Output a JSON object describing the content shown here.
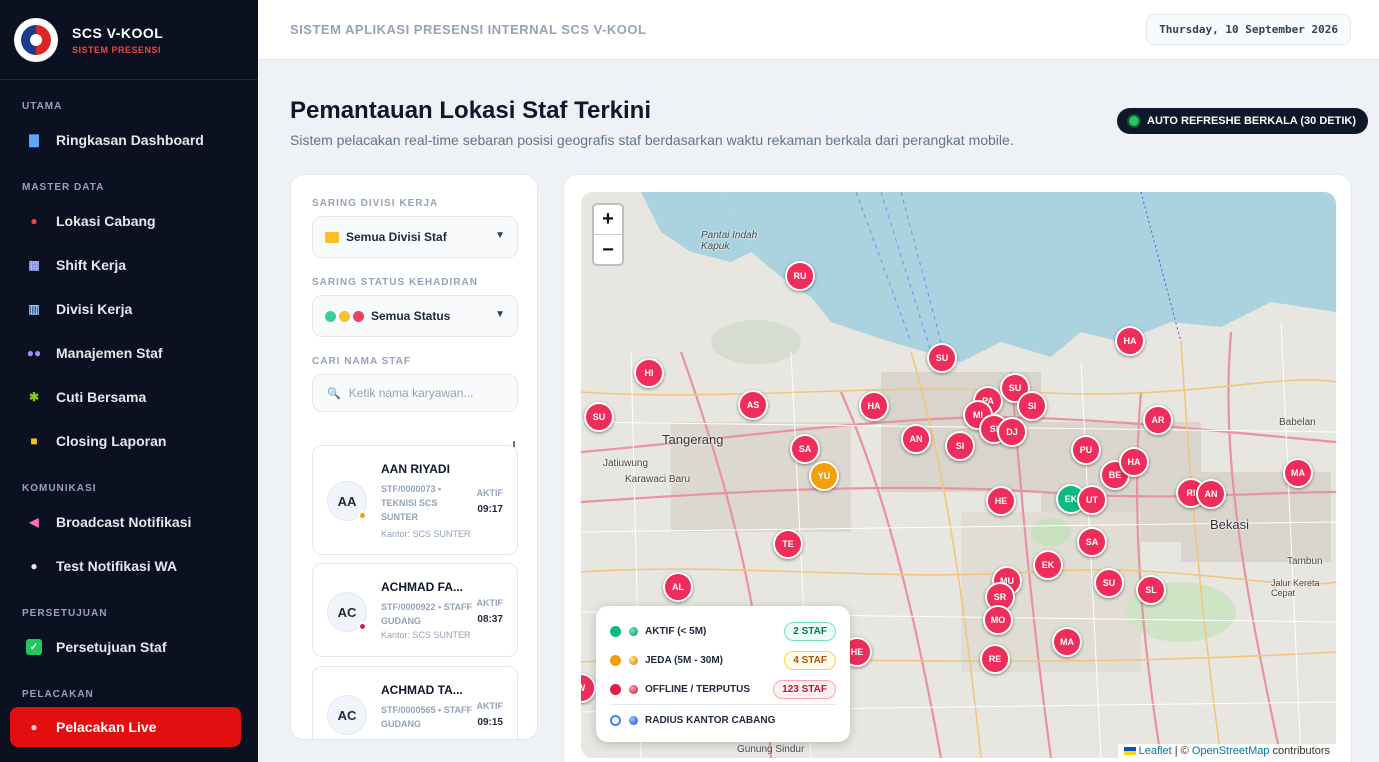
{
  "brand": {
    "title": "SCS V-KOOL",
    "subtitle": "SISTEM PRESENSI"
  },
  "sidebar": {
    "sections": [
      "UTAMA",
      "MASTER DATA",
      "KOMUNIKASI",
      "PERSETUJUAN",
      "PELACAKAN"
    ],
    "items": [
      {
        "label": "Ringkasan Dashboard",
        "icon": "bar-chart-icon"
      },
      {
        "label": "Lokasi Cabang",
        "icon": "pin-icon"
      },
      {
        "label": "Shift Kerja",
        "icon": "calendar-icon"
      },
      {
        "label": "Divisi Kerja",
        "icon": "building-icon"
      },
      {
        "label": "Manajemen Staf",
        "icon": "users-icon"
      },
      {
        "label": "Cuti Bersama",
        "icon": "palm-tree-icon"
      },
      {
        "label": "Closing Laporan",
        "icon": "lock-icon"
      },
      {
        "label": "Broadcast Notifikasi",
        "icon": "megaphone-icon"
      },
      {
        "label": "Test Notifikasi WA",
        "icon": "chat-icon"
      },
      {
        "label": "Persetujuan Staf",
        "icon": "check-icon"
      },
      {
        "label": "Pelacakan Live",
        "icon": "pin-icon",
        "active": true
      }
    ]
  },
  "header": {
    "title": "SISTEM APLIKASI PRESENSI INTERNAL SCS V-KOOL",
    "date": "Thursday, 10 September 2026"
  },
  "page": {
    "title": "Pemantauan Lokasi Staf Terkini",
    "subtitle": "Sistem pelacakan real-time sebaran posisi geografis staf berdasarkan waktu rekaman berkala dari perangkat mobile.",
    "refresh": "AUTO REFRESHE BERKALA (30 DETIK)"
  },
  "filters": {
    "division_label": "SARING DIVISI KERJA",
    "division_value": "Semua Divisi Staf",
    "status_label": "SARING STATUS KEHADIRAN",
    "status_value": "Semua Status",
    "search_label": "CARI NAMA STAF",
    "search_placeholder": "Ketik nama karyawan..."
  },
  "staff": [
    {
      "initials": "AA",
      "name": "AAN RIYADI",
      "id": "STF/0000073 •",
      "role": "TEKNISI SCS SUNTER",
      "kantor": "Kantor: SCS SUNTER",
      "status": "AKTIF",
      "time": "09:17",
      "dot": "#f59e0b"
    },
    {
      "initials": "AC",
      "name": "ACHMAD FA...",
      "id": "STF/0000922 •",
      "role": "STAFF GUDANG",
      "kantor": "Kantor: SCS SUNTER",
      "status": "AKTIF",
      "time": "08:37",
      "dot": "#e11d48"
    },
    {
      "initials": "AC",
      "name": "ACHMAD TA...",
      "id": "STF/0000565 •",
      "role": "STAFF GUDANG",
      "kantor": "",
      "status": "AKTIF",
      "time": "09:15",
      "dot": "#e11d48"
    }
  ],
  "legend": [
    {
      "label": "AKTIF (< 5M)",
      "count": "2 STAF",
      "color": "#10b981",
      "bg": "#ecfdf5",
      "border": "#6ee7b7",
      "text": "#047857"
    },
    {
      "label": "JEDA (5M - 30M)",
      "count": "4 STAF",
      "color": "#f59e0b",
      "bg": "#fffbeb",
      "border": "#fcd34d",
      "text": "#b45309"
    },
    {
      "label": "OFFLINE / TERPUTUS",
      "count": "123 STAF",
      "color": "#e11d48",
      "bg": "#fff1f2",
      "border": "#fda4af",
      "text": "#be123c"
    },
    {
      "label": "RADIUS KANTOR CABANG",
      "count": "",
      "color": "#3b82f6"
    }
  ],
  "map": {
    "zoom_in": "+",
    "zoom_out": "−",
    "attribution_leaflet": "Leaflet",
    "attribution_osm": "OpenStreetMap",
    "attribution_suffix": " contributors",
    "places": [
      "Tangerang",
      "Jatiuwung",
      "Karawaci Baru",
      "Bekasi",
      "Babelan",
      "Tambun",
      "Gunung Sindur",
      "Pantai Indah Kapuk",
      "Jalur Kereta Cepat"
    ],
    "markers": [
      {
        "label": "RU",
        "status": "offline"
      },
      {
        "label": "HI",
        "status": "offline"
      },
      {
        "label": "SU",
        "status": "offline"
      },
      {
        "label": "AS",
        "status": "offline"
      },
      {
        "label": "HA",
        "status": "offline"
      },
      {
        "label": "SU",
        "status": "offline"
      },
      {
        "label": "AN",
        "status": "offline"
      },
      {
        "label": "SA",
        "status": "offline"
      },
      {
        "label": "YU",
        "status": "jeda"
      },
      {
        "label": "SI",
        "status": "offline"
      },
      {
        "label": "PA",
        "status": "offline"
      },
      {
        "label": "MI",
        "status": "offline"
      },
      {
        "label": "SI",
        "status": "offline"
      },
      {
        "label": "SU",
        "status": "offline"
      },
      {
        "label": "SI",
        "status": "offline"
      },
      {
        "label": "DJ",
        "status": "offline"
      },
      {
        "label": "HA",
        "status": "offline"
      },
      {
        "label": "AR",
        "status": "offline"
      },
      {
        "label": "PU",
        "status": "offline"
      },
      {
        "label": "BE",
        "status": "offline"
      },
      {
        "label": "HA",
        "status": "offline"
      },
      {
        "label": "RI",
        "status": "offline"
      },
      {
        "label": "AN",
        "status": "offline"
      },
      {
        "label": "MA",
        "status": "offline"
      },
      {
        "label": "HE",
        "status": "offline"
      },
      {
        "label": "EK",
        "status": "aktif"
      },
      {
        "label": "UT",
        "status": "offline"
      },
      {
        "label": "TE",
        "status": "offline"
      },
      {
        "label": "SA",
        "status": "offline"
      },
      {
        "label": "EK",
        "status": "offline"
      },
      {
        "label": "SU",
        "status": "offline"
      },
      {
        "label": "SL",
        "status": "offline"
      },
      {
        "label": "MU",
        "status": "offline"
      },
      {
        "label": "SR",
        "status": "offline"
      },
      {
        "label": "MO",
        "status": "offline"
      },
      {
        "label": "MA",
        "status": "offline"
      },
      {
        "label": "RE",
        "status": "offline"
      },
      {
        "label": "HE",
        "status": "offline"
      },
      {
        "label": "AL",
        "status": "offline"
      },
      {
        "label": "W",
        "status": "offline"
      }
    ]
  },
  "colors": {
    "offline": "#ef2d5a",
    "jeda": "#f59e0b",
    "aktif": "#10b981",
    "accent": "#e10f0f"
  }
}
